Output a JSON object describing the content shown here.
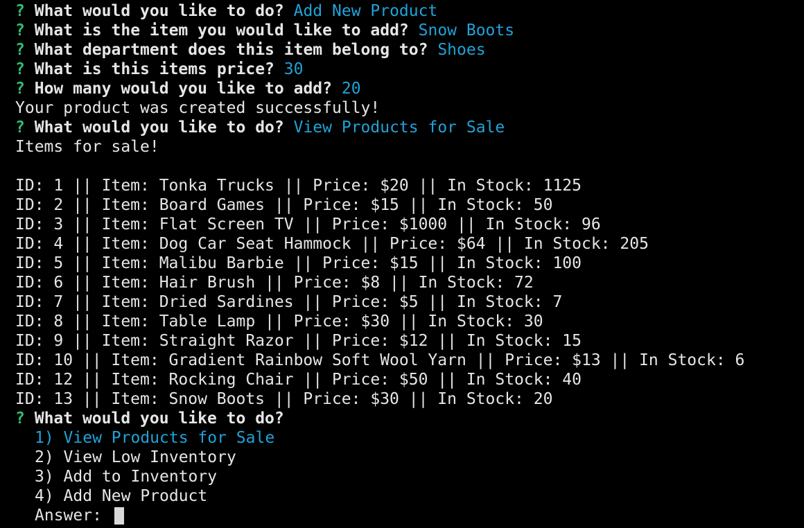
{
  "colors": {
    "background": "#000000",
    "text": "#e6e6e6",
    "question_mark": "#2fbf71",
    "answer": "#1fa3d8"
  },
  "session": {
    "qa": [
      {
        "mark": "?",
        "question": "What would you like to do?",
        "answer": "Add New Product"
      },
      {
        "mark": "?",
        "question": "What is the item you would like to add?",
        "answer": "Snow Boots"
      },
      {
        "mark": "?",
        "question": "What department does this item belong to?",
        "answer": "Shoes"
      },
      {
        "mark": "?",
        "question": "What is this items price?",
        "answer": "30"
      },
      {
        "mark": "?",
        "question": "How many would you like to add?",
        "answer": "20"
      }
    ],
    "success_message": "Your product was created successfully!",
    "second_prompt": {
      "mark": "?",
      "question": "What would you like to do?",
      "answer": "View Products for Sale"
    },
    "items_header": "Items for sale!",
    "products": [
      "ID: 1 || Item: Tonka Trucks || Price: $20 || In Stock: 1125",
      "ID: 2 || Item: Board Games || Price: $15 || In Stock: 50",
      "ID: 3 || Item: Flat Screen TV || Price: $1000 || In Stock: 96",
      "ID: 4 || Item: Dog Car Seat Hammock || Price: $64 || In Stock: 205",
      "ID: 5 || Item: Malibu Barbie || Price: $15 || In Stock: 100",
      "ID: 6 || Item: Hair Brush || Price: $8 || In Stock: 72",
      "ID: 7 || Item: Dried Sardines || Price: $5 || In Stock: 7",
      "ID: 8 || Item: Table Lamp || Price: $30 || In Stock: 30",
      "ID: 9 || Item: Straight Razor || Price: $12 || In Stock: 15",
      "ID: 10 || Item: Gradient Rainbow Soft Wool Yarn || Price: $13 || In Stock: 6",
      "ID: 12 || Item: Rocking Chair || Price: $50 || In Stock: 40",
      "ID: 13 || Item: Snow Boots || Price: $30 || In Stock: 20"
    ],
    "final_prompt": {
      "mark": "?",
      "question": "What would you like to do?"
    },
    "menu_options": [
      "1) View Products for Sale",
      "2) View Low Inventory",
      "3) Add to Inventory",
      "4) Add New Product"
    ],
    "answer_label": "Answer: "
  }
}
